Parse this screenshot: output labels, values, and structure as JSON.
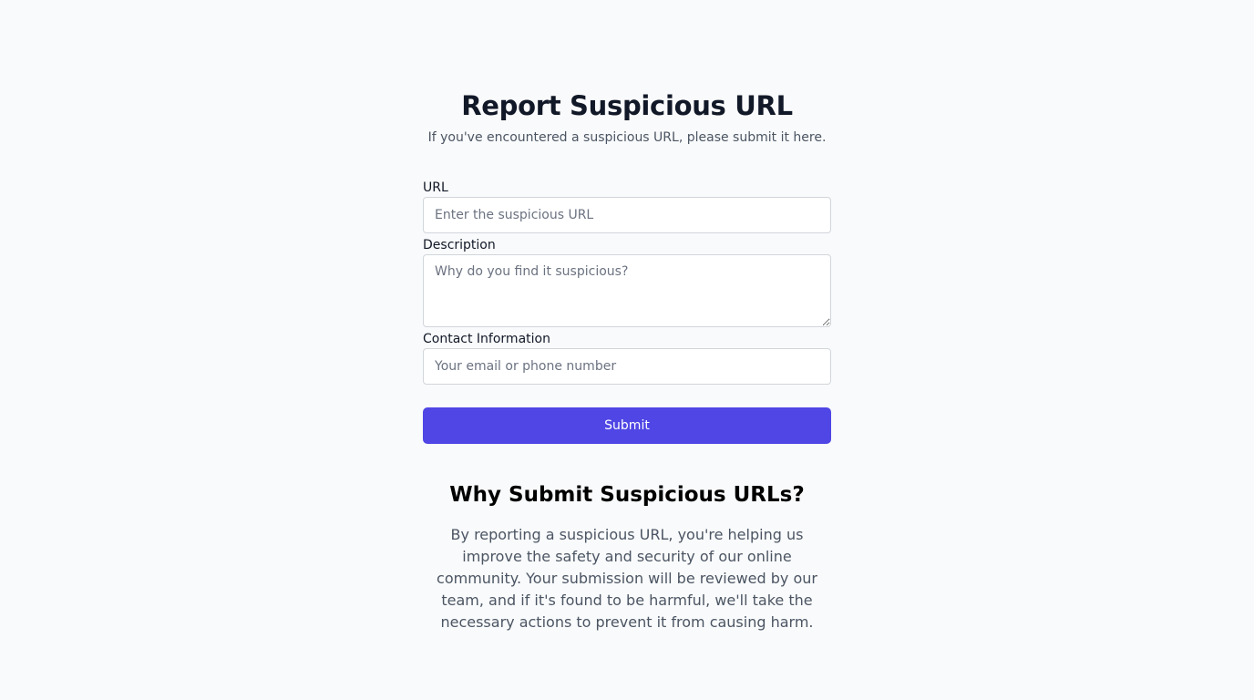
{
  "header": {
    "title": "Report Suspicious URL",
    "subtitle": "If you've encountered a suspicious URL, please submit it here."
  },
  "form": {
    "url": {
      "label": "URL",
      "placeholder": "Enter the suspicious URL",
      "value": ""
    },
    "description": {
      "label": "Description",
      "placeholder": "Why do you find it suspicious?",
      "value": ""
    },
    "contact": {
      "label": "Contact Information",
      "placeholder": "Your email or phone number",
      "value": ""
    },
    "submit_label": "Submit"
  },
  "info": {
    "title": "Why Submit Suspicious URLs?",
    "text": "By reporting a suspicious URL, you're helping us improve the safety and security of our online community. Your submission will be reviewed by our team, and if it's found to be harmful, we'll take the necessary actions to prevent it from causing harm."
  },
  "colors": {
    "background": "#f9fafb",
    "accent": "#4f46e5",
    "heading": "#111827",
    "muted_text": "#4b5563",
    "input_border": "#d1d5db"
  }
}
